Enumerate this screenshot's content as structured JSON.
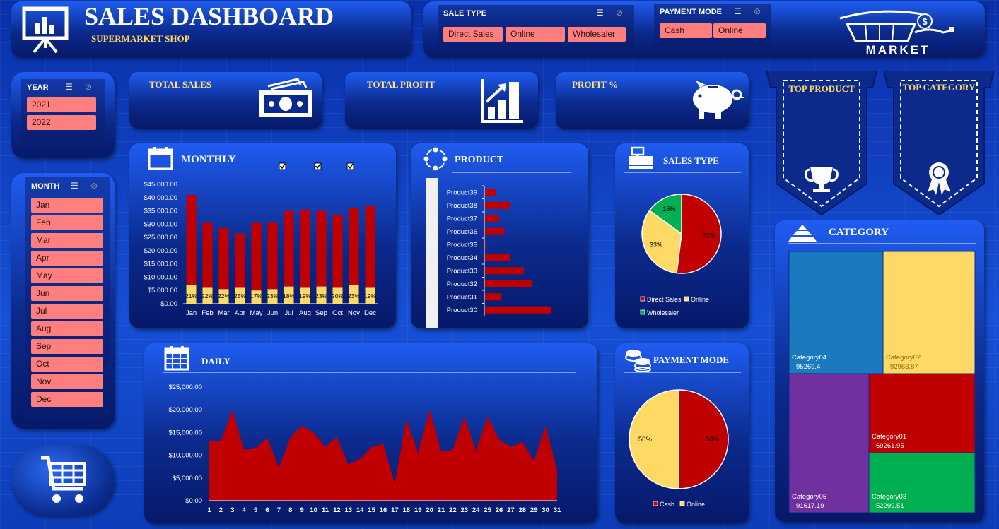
{
  "header": {
    "title": "SALES DASHBOARD",
    "subtitle": "SUPERMARKET SHOP",
    "logo_text": "MARKET"
  },
  "slicers": {
    "sale_type": {
      "label": "SALE TYPE",
      "items": [
        "Direct Sales",
        "Online",
        "Wholesaler"
      ]
    },
    "payment_mode": {
      "label": "PAYMENT MODE",
      "items": [
        "Cash",
        "Online"
      ]
    },
    "year": {
      "label": "YEAR",
      "items": [
        "2021",
        "2022"
      ]
    },
    "month": {
      "label": "MONTH",
      "items": [
        "Jan",
        "Feb",
        "Mar",
        "Apr",
        "May",
        "Jun",
        "Jul",
        "Aug",
        "Sep",
        "Oct",
        "Nov",
        "Dec"
      ]
    }
  },
  "kpis": {
    "total_sales": "TOTAL SALES",
    "total_profit": "TOTAL PROFIT",
    "profit_pct": "PROFIT %"
  },
  "ribbons": {
    "top_product": "TOP PRODUCT",
    "top_category": "TOP CATEGORY"
  },
  "panels": {
    "monthly": "MONTHLY",
    "product": "PRODUCT",
    "sales_type": "SALES TYPE",
    "daily": "DAILY",
    "payment_mode": "PAYMENT MODE",
    "category": "CATEGORY"
  },
  "colors": {
    "red": "#c00000",
    "yellow": "#ffd966",
    "green": "#00b050",
    "blue": "#1a7ac0",
    "purple": "#7030a0",
    "slicer": "#ff7f7f"
  },
  "chart_data": [
    {
      "id": "monthly",
      "type": "bar",
      "categories": [
        "Jan",
        "Feb",
        "Mar",
        "Apr",
        "May",
        "Jun",
        "Jul",
        "Aug",
        "Sep",
        "Oct",
        "Nov",
        "Dec"
      ],
      "series": [
        {
          "name": "",
          "values": [
            41000,
            30500,
            28500,
            26500,
            30500,
            30500,
            35000,
            35500,
            35000,
            33500,
            36000,
            36800
          ]
        }
      ],
      "profit_labels": [
        "21%",
        "22%",
        "22%",
        "25%",
        "17%",
        "23%",
        "18%",
        "19%",
        "23%",
        "20%",
        "23%",
        "19%"
      ],
      "profit_values": [
        7000,
        6000,
        5500,
        6000,
        5000,
        5500,
        6500,
        6000,
        6500,
        6000,
        7000,
        6000
      ],
      "ylim": [
        0,
        45000
      ],
      "yticks": [
        "$0.00",
        "$5,000.00",
        "$10,000.00",
        "$15,000.00",
        "$20,000.00",
        "$25,000.00",
        "$30,000.00",
        "$35,000.00",
        "$40,000.00",
        "$45,000.00"
      ],
      "checkboxes": 3
    },
    {
      "id": "product",
      "type": "bar",
      "orientation": "horizontal",
      "categories": [
        "Product39",
        "Product38",
        "Product37",
        "Product36",
        "Product35",
        "Product34",
        "Product33",
        "Product32",
        "Product31",
        "Product30"
      ],
      "values": [
        4,
        9,
        5,
        7,
        0.5,
        9,
        14,
        17,
        6,
        24
      ]
    },
    {
      "id": "sales_type",
      "type": "pie",
      "labels": [
        "Direct Sales",
        "Online",
        "Wholesaler"
      ],
      "values": [
        52,
        33,
        15
      ],
      "data_labels": [
        "52%",
        "33%",
        "15%"
      ]
    },
    {
      "id": "daily",
      "type": "area",
      "x": [
        1,
        2,
        3,
        4,
        5,
        6,
        7,
        8,
        9,
        10,
        11,
        12,
        13,
        14,
        15,
        16,
        17,
        18,
        19,
        20,
        21,
        22,
        23,
        24,
        25,
        26,
        27,
        28,
        29,
        30,
        31
      ],
      "values": [
        13200,
        13100,
        20000,
        11200,
        11500,
        13900,
        7200,
        14000,
        16500,
        15000,
        11800,
        14000,
        8000,
        9200,
        11800,
        12500,
        3800,
        18000,
        10500,
        20000,
        10800,
        11200,
        18500,
        11000,
        18500,
        13500,
        11800,
        13000,
        8700,
        16500,
        6700
      ],
      "ylim": [
        0,
        25000
      ],
      "yticks": [
        "$0.00",
        "$5,000.00",
        "$10,000.00",
        "$15,000.00",
        "$20,000.00",
        "$25,000.00"
      ]
    },
    {
      "id": "payment_mode",
      "type": "pie",
      "labels": [
        "Cash",
        "Online"
      ],
      "values": [
        50,
        50
      ],
      "data_labels": [
        "50%",
        "50%"
      ]
    },
    {
      "id": "category",
      "type": "treemap",
      "labels": [
        "Category04",
        "Category02",
        "Category05",
        "Category01",
        "Category03"
      ],
      "values": [
        "95269.4",
        "92963.87",
        "91617.19",
        "69261.95",
        "52299.51"
      ]
    }
  ]
}
